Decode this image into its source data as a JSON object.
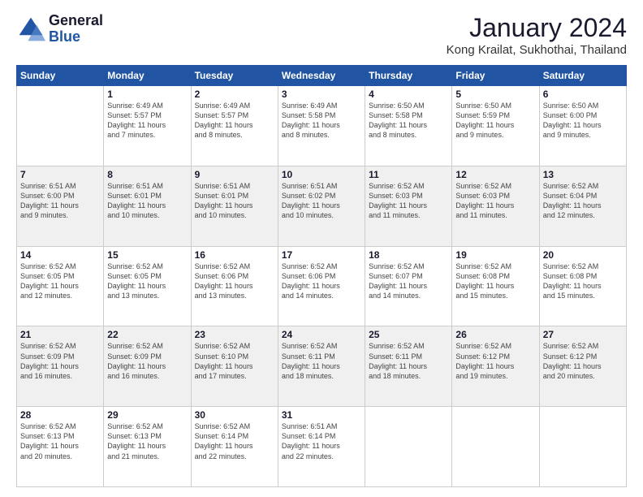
{
  "logo": {
    "general": "General",
    "blue": "Blue"
  },
  "header": {
    "month": "January 2024",
    "location": "Kong Krailat, Sukhothai, Thailand"
  },
  "days_of_week": [
    "Sunday",
    "Monday",
    "Tuesday",
    "Wednesday",
    "Thursday",
    "Friday",
    "Saturday"
  ],
  "weeks": [
    [
      {
        "day": "",
        "info": ""
      },
      {
        "day": "1",
        "info": "Sunrise: 6:49 AM\nSunset: 5:57 PM\nDaylight: 11 hours\nand 7 minutes."
      },
      {
        "day": "2",
        "info": "Sunrise: 6:49 AM\nSunset: 5:57 PM\nDaylight: 11 hours\nand 8 minutes."
      },
      {
        "day": "3",
        "info": "Sunrise: 6:49 AM\nSunset: 5:58 PM\nDaylight: 11 hours\nand 8 minutes."
      },
      {
        "day": "4",
        "info": "Sunrise: 6:50 AM\nSunset: 5:58 PM\nDaylight: 11 hours\nand 8 minutes."
      },
      {
        "day": "5",
        "info": "Sunrise: 6:50 AM\nSunset: 5:59 PM\nDaylight: 11 hours\nand 9 minutes."
      },
      {
        "day": "6",
        "info": "Sunrise: 6:50 AM\nSunset: 6:00 PM\nDaylight: 11 hours\nand 9 minutes."
      }
    ],
    [
      {
        "day": "7",
        "info": "Sunrise: 6:51 AM\nSunset: 6:00 PM\nDaylight: 11 hours\nand 9 minutes."
      },
      {
        "day": "8",
        "info": "Sunrise: 6:51 AM\nSunset: 6:01 PM\nDaylight: 11 hours\nand 10 minutes."
      },
      {
        "day": "9",
        "info": "Sunrise: 6:51 AM\nSunset: 6:01 PM\nDaylight: 11 hours\nand 10 minutes."
      },
      {
        "day": "10",
        "info": "Sunrise: 6:51 AM\nSunset: 6:02 PM\nDaylight: 11 hours\nand 10 minutes."
      },
      {
        "day": "11",
        "info": "Sunrise: 6:52 AM\nSunset: 6:03 PM\nDaylight: 11 hours\nand 11 minutes."
      },
      {
        "day": "12",
        "info": "Sunrise: 6:52 AM\nSunset: 6:03 PM\nDaylight: 11 hours\nand 11 minutes."
      },
      {
        "day": "13",
        "info": "Sunrise: 6:52 AM\nSunset: 6:04 PM\nDaylight: 11 hours\nand 12 minutes."
      }
    ],
    [
      {
        "day": "14",
        "info": "Sunrise: 6:52 AM\nSunset: 6:05 PM\nDaylight: 11 hours\nand 12 minutes."
      },
      {
        "day": "15",
        "info": "Sunrise: 6:52 AM\nSunset: 6:05 PM\nDaylight: 11 hours\nand 13 minutes."
      },
      {
        "day": "16",
        "info": "Sunrise: 6:52 AM\nSunset: 6:06 PM\nDaylight: 11 hours\nand 13 minutes."
      },
      {
        "day": "17",
        "info": "Sunrise: 6:52 AM\nSunset: 6:06 PM\nDaylight: 11 hours\nand 14 minutes."
      },
      {
        "day": "18",
        "info": "Sunrise: 6:52 AM\nSunset: 6:07 PM\nDaylight: 11 hours\nand 14 minutes."
      },
      {
        "day": "19",
        "info": "Sunrise: 6:52 AM\nSunset: 6:08 PM\nDaylight: 11 hours\nand 15 minutes."
      },
      {
        "day": "20",
        "info": "Sunrise: 6:52 AM\nSunset: 6:08 PM\nDaylight: 11 hours\nand 15 minutes."
      }
    ],
    [
      {
        "day": "21",
        "info": "Sunrise: 6:52 AM\nSunset: 6:09 PM\nDaylight: 11 hours\nand 16 minutes."
      },
      {
        "day": "22",
        "info": "Sunrise: 6:52 AM\nSunset: 6:09 PM\nDaylight: 11 hours\nand 16 minutes."
      },
      {
        "day": "23",
        "info": "Sunrise: 6:52 AM\nSunset: 6:10 PM\nDaylight: 11 hours\nand 17 minutes."
      },
      {
        "day": "24",
        "info": "Sunrise: 6:52 AM\nSunset: 6:11 PM\nDaylight: 11 hours\nand 18 minutes."
      },
      {
        "day": "25",
        "info": "Sunrise: 6:52 AM\nSunset: 6:11 PM\nDaylight: 11 hours\nand 18 minutes."
      },
      {
        "day": "26",
        "info": "Sunrise: 6:52 AM\nSunset: 6:12 PM\nDaylight: 11 hours\nand 19 minutes."
      },
      {
        "day": "27",
        "info": "Sunrise: 6:52 AM\nSunset: 6:12 PM\nDaylight: 11 hours\nand 20 minutes."
      }
    ],
    [
      {
        "day": "28",
        "info": "Sunrise: 6:52 AM\nSunset: 6:13 PM\nDaylight: 11 hours\nand 20 minutes."
      },
      {
        "day": "29",
        "info": "Sunrise: 6:52 AM\nSunset: 6:13 PM\nDaylight: 11 hours\nand 21 minutes."
      },
      {
        "day": "30",
        "info": "Sunrise: 6:52 AM\nSunset: 6:14 PM\nDaylight: 11 hours\nand 22 minutes."
      },
      {
        "day": "31",
        "info": "Sunrise: 6:51 AM\nSunset: 6:14 PM\nDaylight: 11 hours\nand 22 minutes."
      },
      {
        "day": "",
        "info": ""
      },
      {
        "day": "",
        "info": ""
      },
      {
        "day": "",
        "info": ""
      }
    ]
  ]
}
